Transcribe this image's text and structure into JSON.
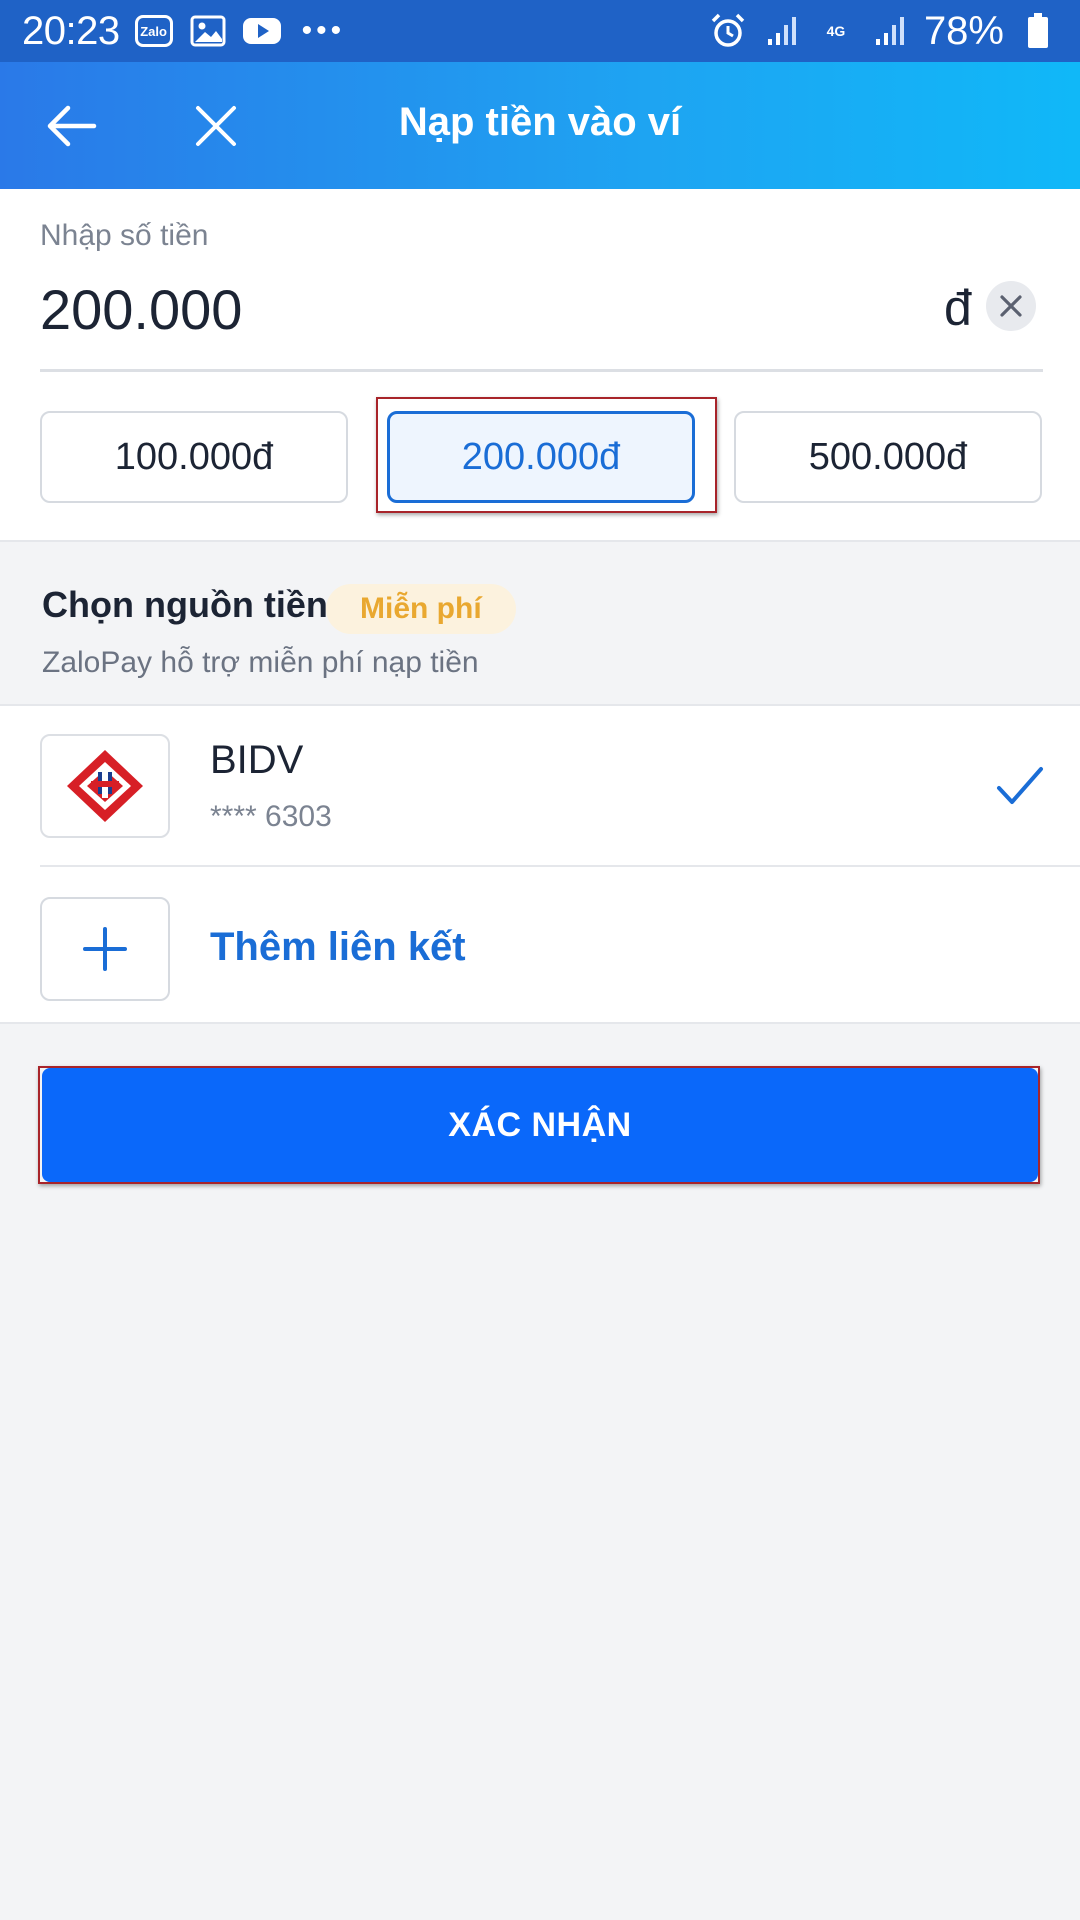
{
  "status_bar": {
    "time": "20:23",
    "zalo_badge": "Zalo",
    "network": "4G",
    "battery": "78%",
    "icons": [
      "zalo-icon",
      "image-icon",
      "youtube-icon",
      "more-dots-icon",
      "alarm-icon",
      "signal-icon",
      "network-arrows-icon",
      "battery-icon"
    ]
  },
  "header": {
    "title": "Nạp tiền vào ví",
    "icons": [
      "back-arrow-icon",
      "close-icon"
    ]
  },
  "amount": {
    "label": "Nhập số tiền",
    "value": "200.000",
    "currency": "đ"
  },
  "presets": [
    {
      "label": "100.000đ",
      "selected": false
    },
    {
      "label": "200.000đ",
      "selected": true
    },
    {
      "label": "500.000đ",
      "selected": false
    }
  ],
  "source": {
    "title": "Chọn nguồn tiền",
    "badge": "Miễn phí",
    "subtitle": "ZaloPay hỗ trợ miễn phí nạp tiền"
  },
  "bank": {
    "name": "BIDV",
    "account": "**** 6303",
    "selected": true
  },
  "add_link": {
    "label": "Thêm liên kết"
  },
  "confirm": {
    "label": "XÁC NHẬN"
  },
  "colors": {
    "accent": "#1a6dd6",
    "button": "#0a68fa",
    "badge_bg": "#fcf2de",
    "badge_text": "#e9a830",
    "highlight": "#a8242a"
  }
}
